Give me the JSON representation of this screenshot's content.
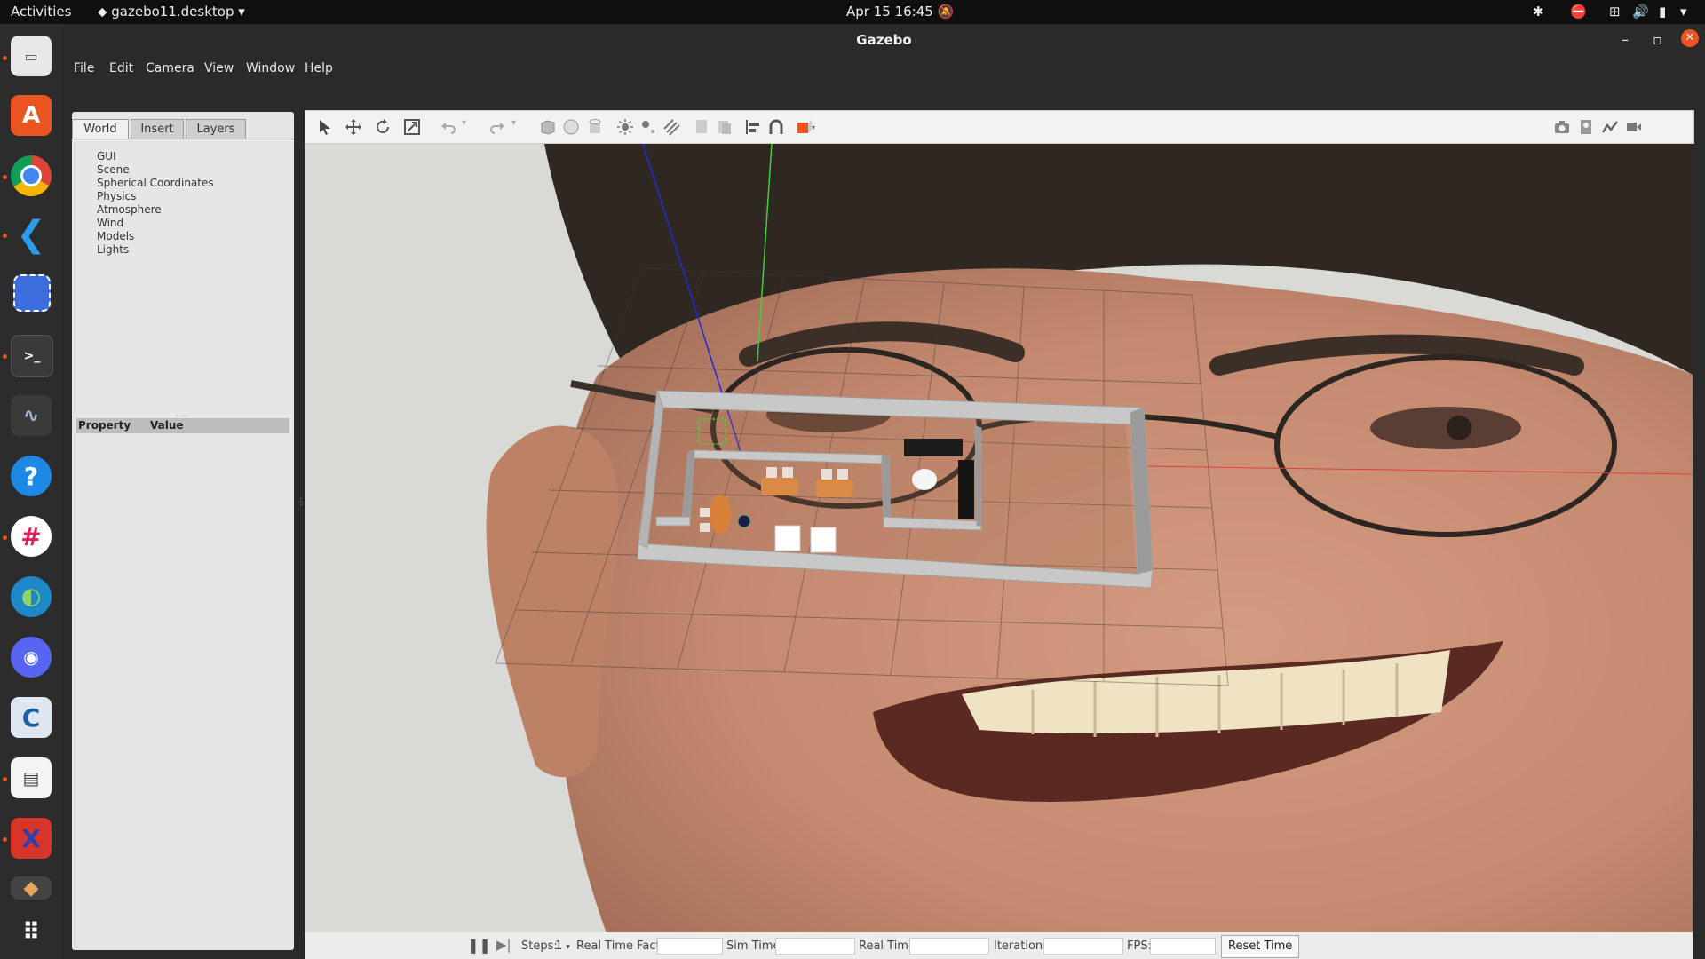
{
  "topbar": {
    "activities": "Activities",
    "app_menu": "gazebo11.desktop",
    "clock": "Apr 15  16:45"
  },
  "dock": {
    "items": [
      "files-icon",
      "ubuntu-software-icon",
      "chrome-icon",
      "vscode-icon",
      "screenshot-icon",
      "terminal-icon",
      "system-monitor-icon",
      "help-icon",
      "slack-icon",
      "app-icon",
      "discord-icon",
      "app2-icon",
      "document-viewer-icon",
      "app3-icon",
      "app4-icon",
      "show-apps-icon"
    ]
  },
  "window": {
    "title": "Gazebo",
    "menu": [
      "File",
      "Edit",
      "Camera",
      "View",
      "Window",
      "Help"
    ]
  },
  "left_panel": {
    "tabs": [
      "World",
      "Insert",
      "Layers"
    ],
    "tree": [
      "GUI",
      "Scene",
      "Spherical Coordinates",
      "Physics",
      "Atmosphere",
      "Wind",
      "Models",
      "Lights"
    ],
    "property_header": "Property",
    "value_header": "Value"
  },
  "bottom": {
    "steps_label": "Steps:",
    "steps_value": "1",
    "rtf_label": "Real Time Factor:",
    "sim_time_label": "Sim Time:",
    "real_time_label": "Real Time:",
    "iterations_label": "Iterations:",
    "fps_label": "FPS:",
    "reset_button": "Reset Time"
  },
  "colors": {
    "accent": "#e95420",
    "skin": "#c98d70",
    "wall": "#c8c8c8"
  }
}
